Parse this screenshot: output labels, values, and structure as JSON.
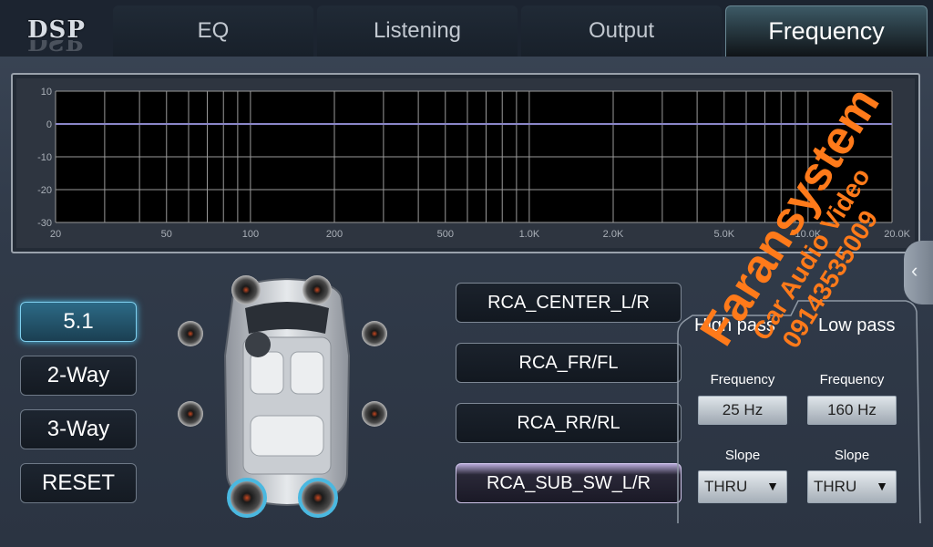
{
  "logo": {
    "text": "DSP"
  },
  "tabs": [
    {
      "label": "EQ"
    },
    {
      "label": "Listening"
    },
    {
      "label": "Output"
    },
    {
      "label": "Frequency"
    }
  ],
  "graph": {
    "y_ticks": [
      "10",
      "0",
      "-10",
      "-20",
      "-30"
    ],
    "x_ticks": [
      "20",
      "50",
      "100",
      "200",
      "500",
      "1.0K",
      "2.0K",
      "5.0K",
      "10.0K",
      "20.0K"
    ],
    "line_color": "#8a86c8"
  },
  "presets": [
    {
      "label": "5.1"
    },
    {
      "label": "2-Way"
    },
    {
      "label": "3-Way"
    },
    {
      "label": "RESET"
    }
  ],
  "channels": [
    {
      "label": "RCA_CENTER_L/R"
    },
    {
      "label": "RCA_FR/FL"
    },
    {
      "label": "RCA_RR/RL"
    },
    {
      "label": "RCA_SUB_SW_L/R"
    }
  ],
  "filter": {
    "high_pass_label": "High pass",
    "low_pass_label": "Low pass",
    "hp_frequency_label": "Frequency",
    "lp_frequency_label": "Frequency",
    "hp_frequency": "25 Hz",
    "lp_frequency": "160 Hz",
    "hp_slope_label": "Slope",
    "lp_slope_label": "Slope",
    "hp_slope": "THRU",
    "lp_slope": "THRU"
  },
  "watermark": {
    "line1": "Faransystem",
    "line2": "Car Audio Video",
    "line3": "09143535009"
  },
  "colors": {
    "accent_active": "#4ab8e0",
    "watermark": "#ff7a1a"
  }
}
